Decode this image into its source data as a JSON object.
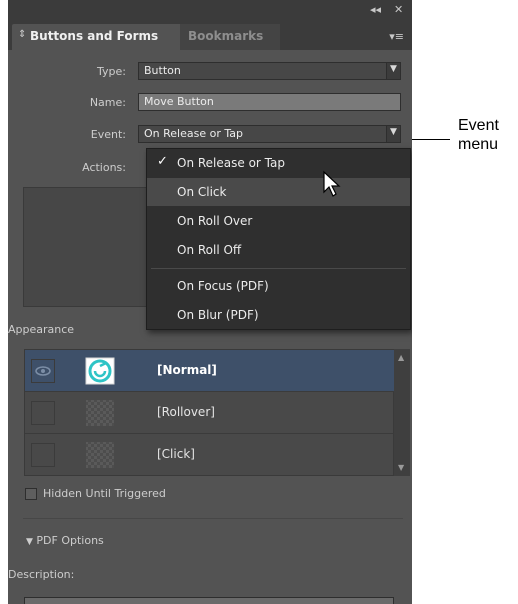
{
  "panel": {
    "tabs": [
      {
        "label": "Buttons and Forms"
      },
      {
        "label": "Bookmarks"
      }
    ],
    "title_controls": {
      "collapse": "◂◂",
      "close": "✕"
    },
    "menu_icon": "▾≡"
  },
  "form": {
    "type_label": "Type:",
    "type_value": "Button",
    "name_label": "Name:",
    "name_value": "Move Button",
    "event_label": "Event:",
    "event_value": "On Release or Tap",
    "actions_label": "Actions:"
  },
  "event_menu": {
    "items": [
      {
        "label": "On Release or Tap",
        "checked": true
      },
      {
        "label": "On Click",
        "hover": true
      },
      {
        "label": "On Roll Over"
      },
      {
        "label": "On Roll Off"
      },
      {
        "label": "On Focus (PDF)"
      },
      {
        "label": "On Blur (PDF)"
      }
    ],
    "check_glyph": "✓"
  },
  "appearance": {
    "label": "Appearance",
    "states": [
      {
        "name": "[Normal]",
        "selected": true
      },
      {
        "name": "[Rollover]",
        "selected": false
      },
      {
        "name": "[Click]",
        "selected": false
      }
    ]
  },
  "hidden_until_triggered": {
    "label": "Hidden Until Triggered",
    "checked": false
  },
  "pdf_options": {
    "label": "PDF Options",
    "expanded": true
  },
  "description": {
    "label": "Description:",
    "value": ""
  },
  "callout": {
    "line1": "Event",
    "line2": "menu"
  },
  "colors": {
    "panel_bg": "#535353",
    "selection": "#3e5069",
    "menu_bg": "#2f2f2f",
    "accent_cyan": "#2ec4c6"
  }
}
